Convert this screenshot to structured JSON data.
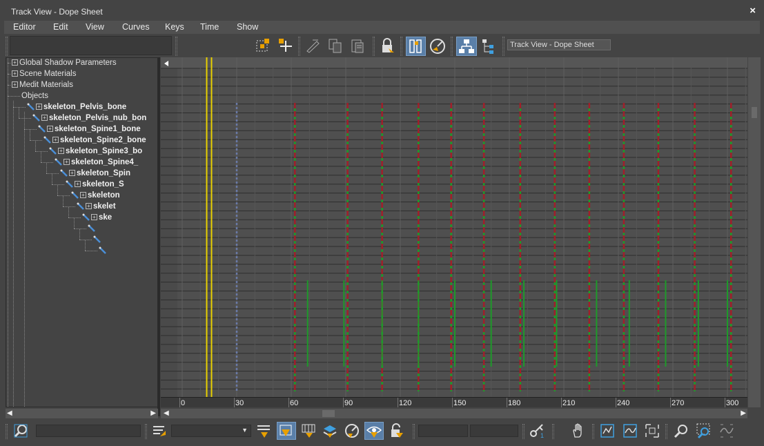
{
  "window": {
    "title": "Track View - Dope Sheet",
    "close_glyph": "×"
  },
  "menu": [
    "Editor",
    "Edit",
    "View",
    "Curves",
    "Keys",
    "Time",
    "Show"
  ],
  "toolbar": {
    "name_field": "Track View - Dope Sheet",
    "icons": [
      "select-keys-icon",
      "add-keys-icon",
      "slide-keys-icon",
      "copy-icon",
      "paste-icon",
      "lock-selection-icon",
      "edit-keys-icon",
      "edit-ranges-icon",
      "filter-icon",
      "show-tree-icon"
    ]
  },
  "tree": {
    "items": [
      {
        "label": "Global Shadow Parameters",
        "bold": false
      },
      {
        "label": "Scene Materials",
        "bold": false
      },
      {
        "label": "Medit Materials",
        "bold": false
      },
      {
        "label": "Objects",
        "bold": false
      },
      {
        "label": "skeleton_Pelvis_bone",
        "bold": true
      },
      {
        "label": "skeleton_Pelvis_nub_bon",
        "bold": true
      },
      {
        "label": "skeleton_Spine1_bone",
        "bold": true
      },
      {
        "label": "skeleton_Spine2_bone",
        "bold": true
      },
      {
        "label": "skeleton_Spine3_bo",
        "bold": true
      },
      {
        "label": "skeleton_Spine4_",
        "bold": true
      },
      {
        "label": "skeleton_Spin",
        "bold": true
      },
      {
        "label": "skeleton_S",
        "bold": true
      },
      {
        "label": "skeleton",
        "bold": true
      },
      {
        "label": "skelet",
        "bold": true
      },
      {
        "label": "ske",
        "bold": true
      },
      {
        "label": "",
        "bold": true
      },
      {
        "label": "",
        "bold": true
      },
      {
        "label": "",
        "bold": true
      }
    ]
  },
  "timeline": {
    "ticks": [
      "0",
      "30",
      "60",
      "90",
      "120",
      "150",
      "180",
      "210",
      "240",
      "270",
      "300"
    ],
    "current_frame": 15,
    "red_key_frames": [
      30,
      62,
      91,
      110,
      130,
      148,
      166,
      186,
      205,
      224,
      243,
      262,
      282,
      302,
      318
    ],
    "green_key_frames": [
      69,
      89,
      110,
      130,
      150,
      170,
      188,
      206,
      228,
      246,
      266,
      284,
      300
    ]
  },
  "colors": {
    "background": "#444444",
    "dope_bg": "#4f4f4f",
    "time_slider": "#e8d000",
    "red_key": "#a0202a",
    "green_key": "#1e9a2a",
    "active_button": "#5a7fa8"
  }
}
